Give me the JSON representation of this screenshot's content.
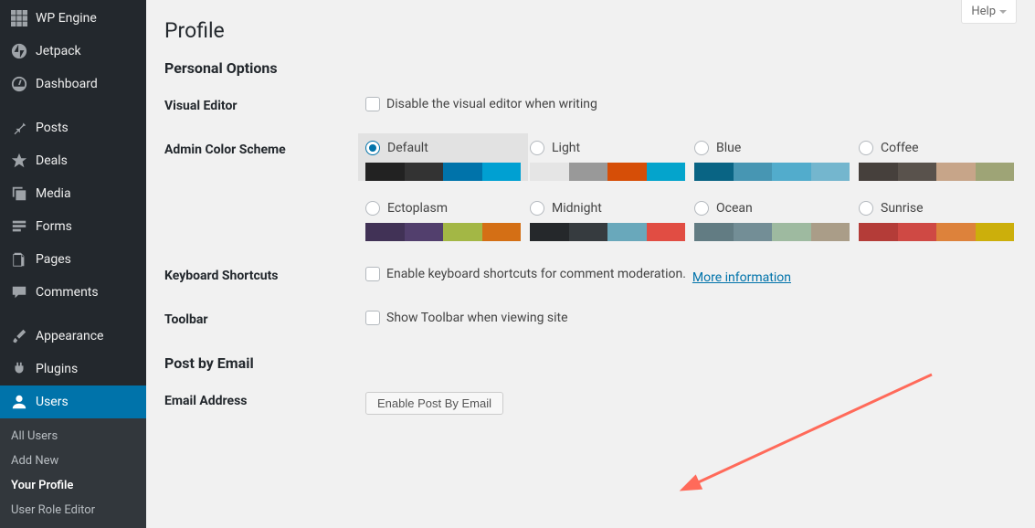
{
  "sidebar": {
    "items": [
      {
        "label": "WP Engine",
        "icon": "wpengine"
      },
      {
        "label": "Jetpack",
        "icon": "jetpack"
      },
      {
        "label": "Dashboard",
        "icon": "dashboard"
      },
      {
        "label": "Posts",
        "icon": "pin"
      },
      {
        "label": "Deals",
        "icon": "star"
      },
      {
        "label": "Media",
        "icon": "media"
      },
      {
        "label": "Forms",
        "icon": "forms"
      },
      {
        "label": "Pages",
        "icon": "pages"
      },
      {
        "label": "Comments",
        "icon": "comments"
      },
      {
        "label": "Appearance",
        "icon": "brush"
      },
      {
        "label": "Plugins",
        "icon": "plug"
      },
      {
        "label": "Users",
        "icon": "user",
        "active": true
      }
    ],
    "submenu": [
      {
        "label": "All Users"
      },
      {
        "label": "Add New"
      },
      {
        "label": "Your Profile",
        "current": true
      },
      {
        "label": "User Role Editor"
      }
    ]
  },
  "header": {
    "help": "Help"
  },
  "page": {
    "title": "Profile",
    "sections": {
      "personal": "Personal Options",
      "post_email": "Post by Email"
    },
    "rows": {
      "visual_editor": {
        "label": "Visual Editor",
        "text": "Disable the visual editor when writing"
      },
      "color_scheme": {
        "label": "Admin Color Scheme"
      },
      "shortcuts": {
        "label": "Keyboard Shortcuts",
        "text": "Enable keyboard shortcuts for comment moderation.",
        "link": "More information"
      },
      "toolbar": {
        "label": "Toolbar",
        "text": "Show Toolbar when viewing site"
      },
      "email_address": {
        "label": "Email Address",
        "button": "Enable Post By Email"
      }
    },
    "schemes": [
      {
        "name": "Default",
        "selected": true,
        "colors": [
          "#222222",
          "#333333",
          "#0073aa",
          "#00a0d2"
        ]
      },
      {
        "name": "Light",
        "selected": false,
        "colors": [
          "#e5e5e5",
          "#999999",
          "#d64e07",
          "#04a4cc"
        ]
      },
      {
        "name": "Blue",
        "selected": false,
        "colors": [
          "#096484",
          "#4796b3",
          "#52accc",
          "#74B6CE"
        ]
      },
      {
        "name": "Coffee",
        "selected": false,
        "colors": [
          "#46403c",
          "#59524c",
          "#c7a589",
          "#9ea476"
        ]
      },
      {
        "name": "Ectoplasm",
        "selected": false,
        "colors": [
          "#413256",
          "#523f6d",
          "#a3b745",
          "#d46f15"
        ]
      },
      {
        "name": "Midnight",
        "selected": false,
        "colors": [
          "#25282b",
          "#363b3f",
          "#69a8bb",
          "#e14d43"
        ]
      },
      {
        "name": "Ocean",
        "selected": false,
        "colors": [
          "#627c83",
          "#738e96",
          "#9ebaa0",
          "#aa9d88"
        ]
      },
      {
        "name": "Sunrise",
        "selected": false,
        "colors": [
          "#b43c38",
          "#cf4944",
          "#dd823b",
          "#ccaf0b"
        ]
      }
    ]
  }
}
